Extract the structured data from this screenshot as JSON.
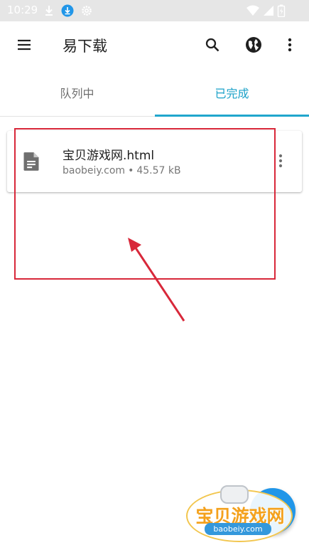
{
  "status_bar": {
    "time": "10:29",
    "icons": [
      "download-arrow-icon",
      "download-badge-icon",
      "settings-gear-icon",
      "wifi-icon",
      "signal-icon",
      "battery-icon"
    ]
  },
  "app_bar": {
    "title": "易下载",
    "menu_icon": "hamburger-menu-icon",
    "actions": [
      "search-icon",
      "globe-icon",
      "more-vert-icon"
    ]
  },
  "tabs": [
    {
      "label": "队列中",
      "selected": false
    },
    {
      "label": "已完成",
      "selected": true
    }
  ],
  "downloads": [
    {
      "name": "宝贝游戏网.html",
      "source": "baobeiy.com",
      "separator": "•",
      "size": "45.57 kB",
      "icon": "document-file-icon"
    }
  ],
  "watermark": {
    "text": "宝贝游戏网",
    "url": "baobeiy.com"
  },
  "colors": {
    "accent": "#21a6cd",
    "annotation": "#d8283a",
    "fab": "#2196e8",
    "status_bar_bg": "#e6e6e6"
  }
}
